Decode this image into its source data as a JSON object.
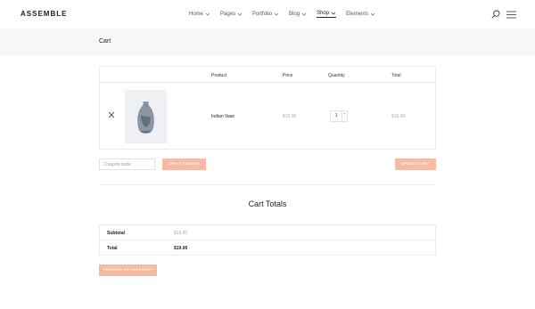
{
  "brand": {
    "logo": "ASSEMBLE"
  },
  "nav": {
    "items": [
      {
        "label": "Home"
      },
      {
        "label": "Pages"
      },
      {
        "label": "Portfolio"
      },
      {
        "label": "Blog"
      },
      {
        "label": "Shop"
      },
      {
        "label": "Elements"
      }
    ],
    "active": "Shop"
  },
  "page": {
    "title": "Cart"
  },
  "cart": {
    "headers": {
      "product": "Product",
      "price": "Price",
      "quantity": "Quantity",
      "total": "Total"
    },
    "item": {
      "name": "Indian Vase",
      "price": "$19.00",
      "quantity": "1",
      "total": "$19.00",
      "image": "vase"
    }
  },
  "coupon": {
    "placeholder": "Coupon code",
    "apply_label": "APPLY COUPON"
  },
  "update_label": "UPDATE CART",
  "totals": {
    "title": "Cart Totals",
    "subtotal_label": "Subtotal",
    "subtotal_value": "$19.00",
    "total_label": "Total",
    "total_value": "$19.00"
  },
  "checkout_label": "PROCEED TO CHECKOUT",
  "colors": {
    "accent": "#f5bba4",
    "title_bar": "#f7f7f7",
    "border": "#ebebeb"
  }
}
